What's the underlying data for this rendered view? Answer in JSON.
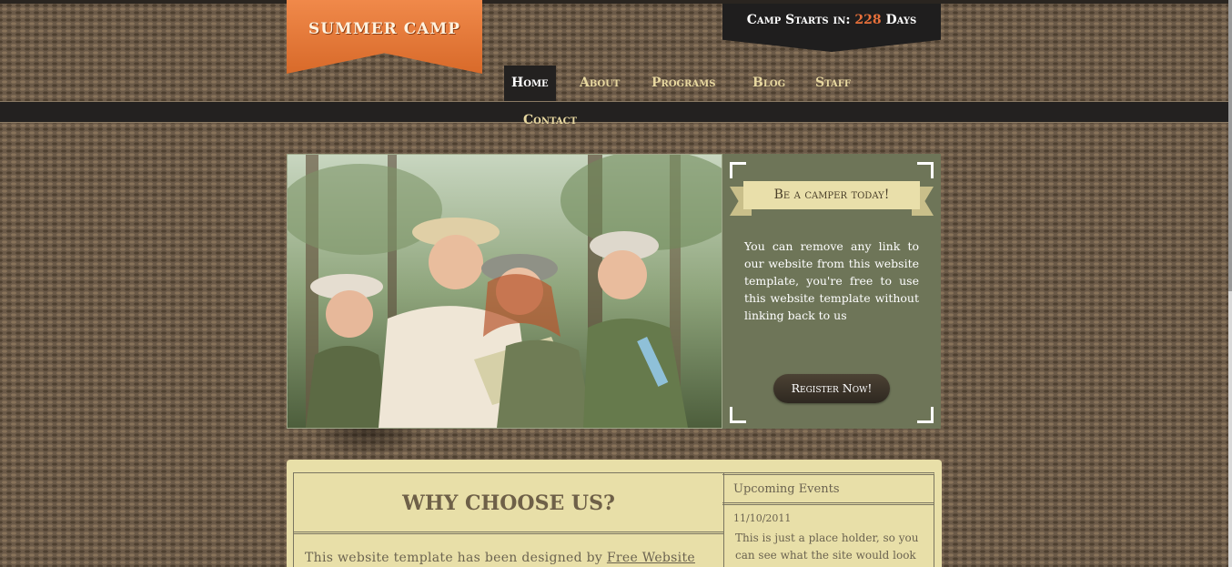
{
  "site": {
    "logo": "Summer Camp"
  },
  "countdown": {
    "prefix": "Camp Starts in: ",
    "days": "228",
    "suffix": " Days"
  },
  "nav": {
    "items": [
      {
        "label": "Home"
      },
      {
        "label": "About"
      },
      {
        "label": "Programs"
      },
      {
        "label": "Blog"
      },
      {
        "label": "Staff"
      },
      {
        "label": "Contact"
      }
    ],
    "active": "Home"
  },
  "promo": {
    "ribbon": "Be a camper today!",
    "text": "You can remove any link to our website from this website template, you're free to use this website template without linking back to us",
    "button": "Register Now!"
  },
  "main": {
    "title": "WHY CHOOSE US?",
    "intro_text": "This website template has been designed by ",
    "intro_link": "Free Website"
  },
  "events": {
    "title": "Upcoming Events",
    "date": "11/10/2011",
    "text": "This is just a place holder, so you can see what the site would look"
  },
  "colors": {
    "accent": "#e8703a",
    "nav_text": "#e8d8a0",
    "promo_bg": "#6e7558",
    "content_bg": "#e8dfa8"
  }
}
